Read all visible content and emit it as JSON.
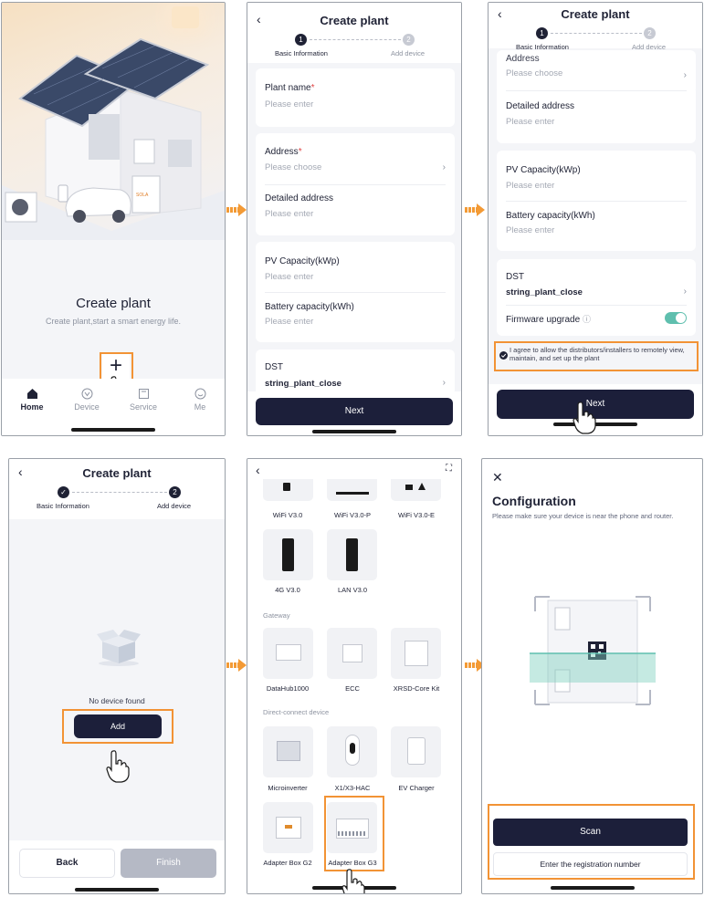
{
  "screen1": {
    "title": "Create plant",
    "subtitle": "Create plant,start a smart energy life.",
    "tabs": [
      {
        "label": "Home",
        "icon": "home-icon",
        "active": true
      },
      {
        "label": "Device",
        "icon": "device-icon",
        "active": false
      },
      {
        "label": "Service",
        "icon": "service-icon",
        "active": false
      },
      {
        "label": "Me",
        "icon": "me-icon",
        "active": false
      }
    ]
  },
  "screen2": {
    "header_title": "Create plant",
    "step1_label": "Basic Information",
    "step2_label": "Add device",
    "step1_num": "1",
    "step2_num": "2",
    "plant_name_label": "Plant name",
    "plant_name_placeholder": "Please enter",
    "address_label": "Address",
    "address_placeholder": "Please choose",
    "detailed_address_label": "Detailed address",
    "detailed_address_placeholder": "Please enter",
    "pv_capacity_label": "PV Capacity(kWp)",
    "pv_capacity_placeholder": "Please enter",
    "battery_capacity_label": "Battery capacity(kWh)",
    "battery_capacity_placeholder": "Please enter",
    "dst_label": "DST",
    "dst_value": "string_plant_close",
    "next_button": "Next"
  },
  "screen3": {
    "header_title": "Create plant",
    "step1_label": "Basic Information",
    "step2_label": "Add device",
    "step1_num": "1",
    "step2_num": "2",
    "address_partial": "Address",
    "address_placeholder": "Please choose",
    "detailed_address_label": "Detailed address",
    "detailed_address_placeholder": "Please enter",
    "pv_capacity_label": "PV Capacity(kWp)",
    "pv_capacity_placeholder": "Please enter",
    "battery_capacity_label": "Battery capacity(kWh)",
    "battery_capacity_placeholder": "Please enter",
    "dst_label": "DST",
    "dst_value": "string_plant_close",
    "firmware_label": "Firmware upgrade",
    "firmware_on": true,
    "agree_text": "I agree to allow the distributors/installers to remotely view, maintain, and set up the plant",
    "next_button": "Next"
  },
  "screen4": {
    "header_title": "Create plant",
    "step1_label": "Basic Information",
    "step2_label": "Add device",
    "step2_num": "2",
    "empty_text": "No device found",
    "add_button": "Add",
    "back_button": "Back",
    "finish_button": "Finish"
  },
  "screen5": {
    "top_devices": [
      "WiFi V3.0",
      "WiFi V3.0-P",
      "WiFi V3.0-E",
      "4G V3.0",
      "LAN V3.0"
    ],
    "gateway_title": "Gateway",
    "gateway_devices": [
      "DataHub1000",
      "ECC",
      "XRSD-Core Kit"
    ],
    "direct_title": "Direct-connect device",
    "direct_devices": [
      "Microinverter",
      "X1/X3-HAC",
      "EV Charger",
      "Adapter Box G2",
      "Adapter Box G3"
    ]
  },
  "screen6": {
    "title": "Configuration",
    "description": "Please make sure your device is near the phone and router.",
    "scan_button": "Scan",
    "register_button": "Enter the registration number"
  },
  "colors": {
    "primary": "#1c1f3a",
    "highlight": "#f29335",
    "toggle": "#5fbfae",
    "placeholder": "#a4a9b4",
    "required": "#e04545"
  }
}
